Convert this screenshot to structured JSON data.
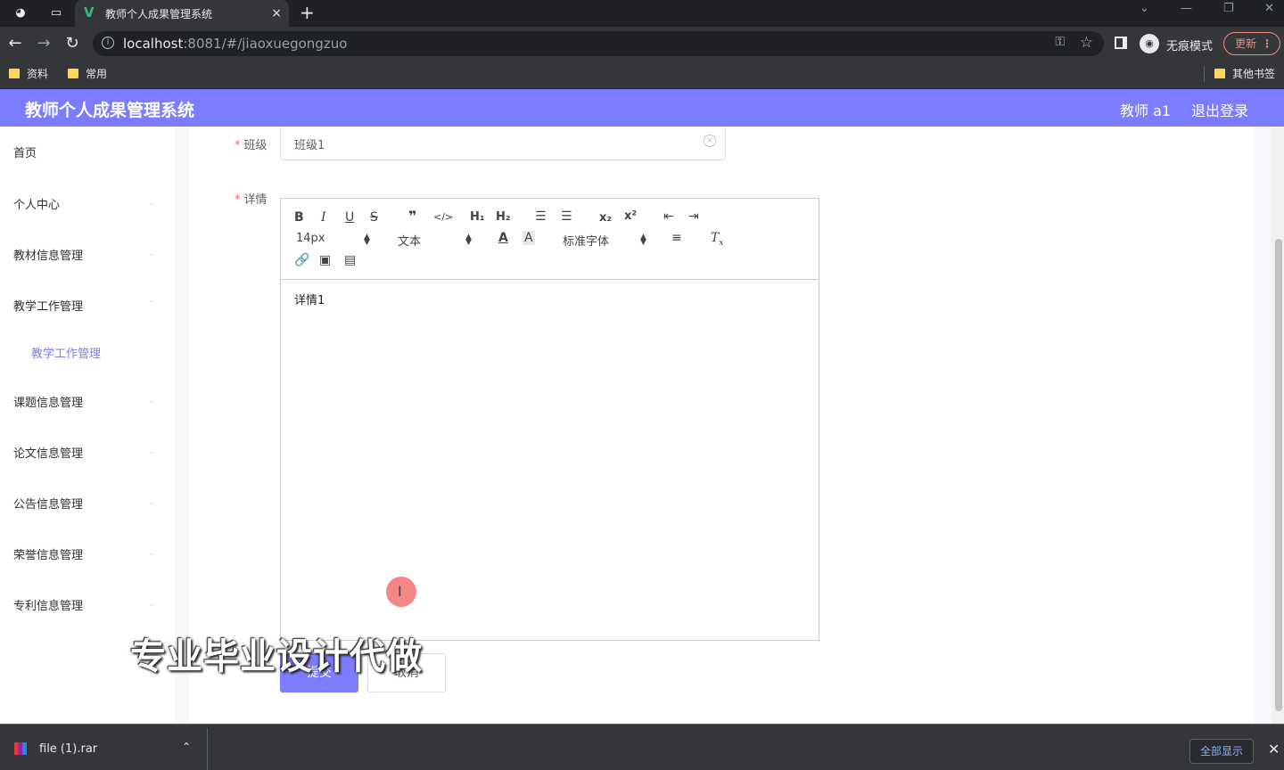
{
  "browser": {
    "tab_title": "教师个人成果管理系统",
    "tab_close": "×",
    "new_tab": "+",
    "url_host": "localhost",
    "url_rest": ":8081/#/jiaoxuegongzuo",
    "incognito_label": "无痕模式",
    "update_label": "更新",
    "bookmarks": [
      "资料",
      "常用"
    ],
    "other_bookmarks": "其他书签"
  },
  "app": {
    "title": "教师个人成果管理系统",
    "user": "教师 a1",
    "logout": "退出登录",
    "accent_color": "#7b7cff"
  },
  "sidebar": {
    "items": [
      {
        "label": "首页"
      },
      {
        "label": "个人中心"
      },
      {
        "label": "教材信息管理"
      },
      {
        "label": "教学工作管理"
      },
      {
        "label": "教学工作管理"
      },
      {
        "label": "课题信息管理"
      },
      {
        "label": "论文信息管理"
      },
      {
        "label": "公告信息管理"
      },
      {
        "label": "荣誉信息管理"
      },
      {
        "label": "专利信息管理"
      }
    ]
  },
  "form": {
    "class_label": "班级",
    "class_value": "班级1",
    "detail_label": "详情",
    "required_mark": "*",
    "editor": {
      "font_size": "14px",
      "block_type": "文本",
      "font_family": "标准字体",
      "content": "详情1"
    },
    "submit_label": "提交",
    "cancel_label": "取消"
  },
  "watermark": "专业毕业设计代做",
  "download": {
    "file_name": "file (1).rar",
    "show_all": "全部显示"
  }
}
